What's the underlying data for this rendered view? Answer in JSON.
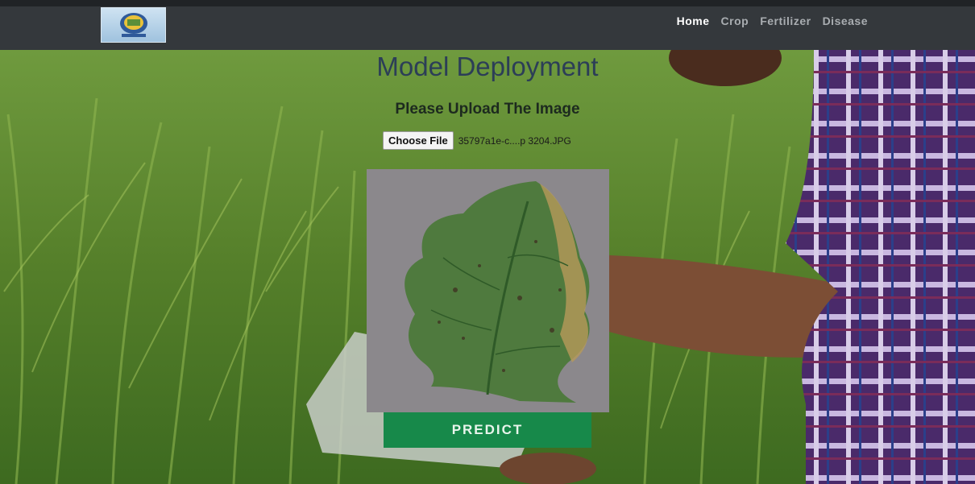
{
  "nav": {
    "logo_icon": "institution-logo",
    "links": [
      {
        "label": "Home",
        "active": true
      },
      {
        "label": "Crop",
        "active": false
      },
      {
        "label": "Fertilizer",
        "active": false
      },
      {
        "label": "Disease",
        "active": false
      }
    ]
  },
  "main": {
    "title": "Model Deployment",
    "subtitle": "Please Upload The Image",
    "file_button_label": "Choose File",
    "file_name": "35797a1e-c....p 3204.JPG",
    "predict_label": "PREDICT"
  },
  "colors": {
    "navbar": "#34383c",
    "predict_button": "#17894a",
    "title_text": "#2c3e57"
  }
}
